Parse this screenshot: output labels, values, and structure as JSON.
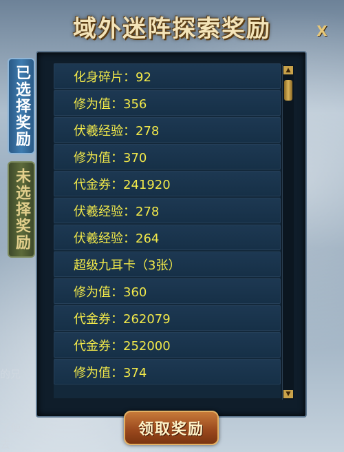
{
  "window": {
    "title": "域外迷阵探索奖励",
    "close_label": "X"
  },
  "tabs": [
    {
      "label": "已选择奖励",
      "active": true
    },
    {
      "label": "未选择奖励",
      "active": false
    }
  ],
  "rewards": [
    "化身碎片：92",
    "修为值：356",
    "伏羲经验：278",
    "修为值：370",
    "代金券：241920",
    "伏羲经验：278",
    "伏羲经验：264",
    "超级九耳卡（3张）",
    "修为值：360",
    "代金券：262079",
    "代金券：252000",
    "修为值：374"
  ],
  "scrollbar": {
    "up_icon": "▲",
    "down_icon": "▼"
  },
  "claim_button": {
    "label": "领取奖励"
  },
  "background_text": {
    "left_mid": "的兄",
    "left_bottom": "了使",
    "left_bottom2": "去"
  }
}
